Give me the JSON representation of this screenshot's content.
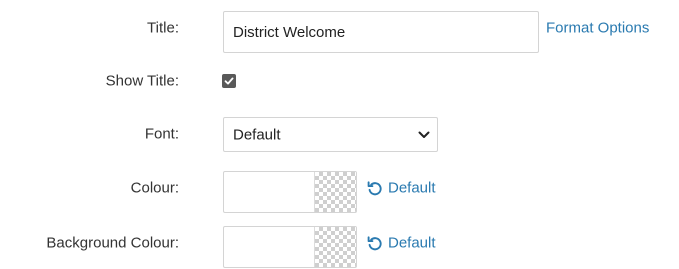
{
  "title_row": {
    "label": "Title:",
    "value": "District Welcome",
    "format_link": "Format Options"
  },
  "show_title_row": {
    "label": "Show Title:",
    "checked": true
  },
  "font_row": {
    "label": "Font:",
    "selected": "Default"
  },
  "colour_row": {
    "label": "Colour:",
    "value": "",
    "default_label": "Default"
  },
  "background_colour_row": {
    "label": "Background Colour:",
    "value": "",
    "default_label": "Default"
  },
  "colors": {
    "link": "#2a7ab0",
    "checkbox_fill": "#595959",
    "border": "#d4d4d4",
    "label_text": "#333333"
  },
  "icons": {
    "checkbox": "check-icon",
    "select": "chevron-down-icon",
    "reset": "reset-icon"
  }
}
